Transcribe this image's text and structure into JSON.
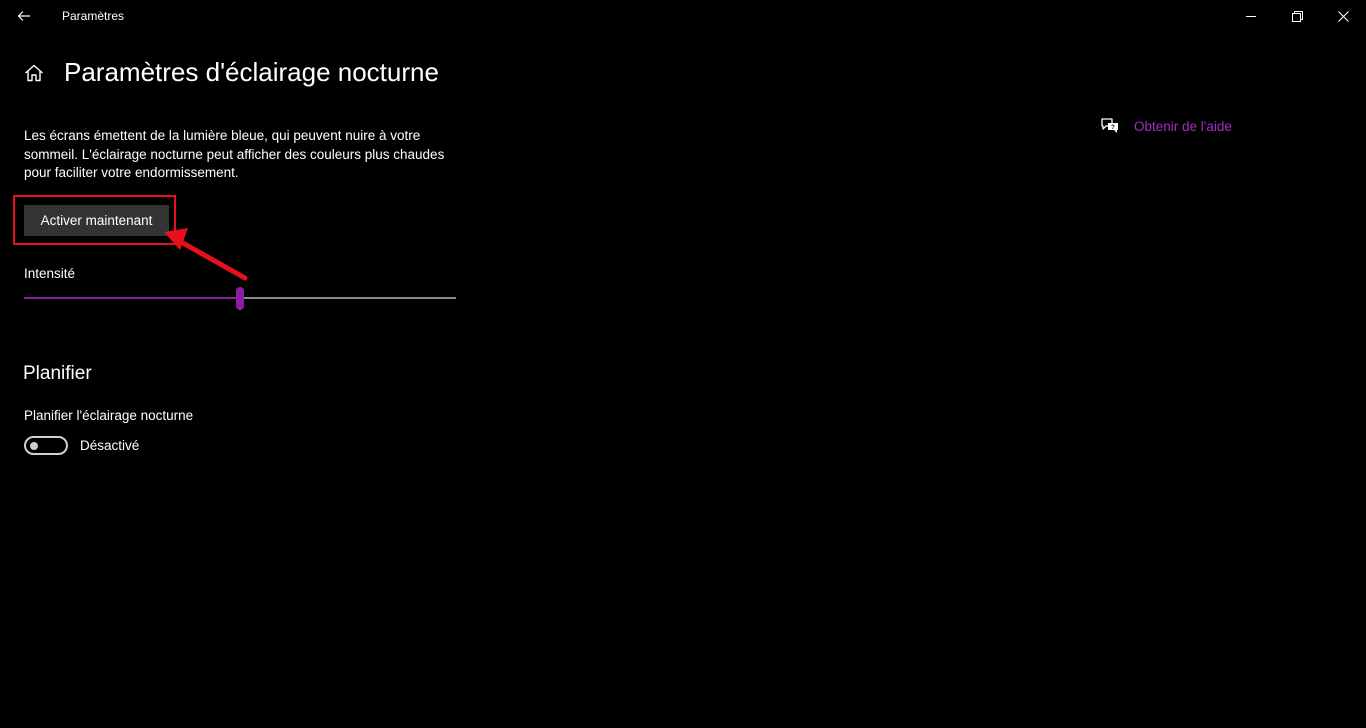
{
  "window": {
    "app_title": "Paramètres",
    "back_icon": "back-arrow-icon",
    "minimize_icon": "minimize-icon",
    "maximize_icon": "restore-icon",
    "close_icon": "close-icon"
  },
  "page": {
    "home_icon": "home-icon",
    "title": "Paramètres d'éclairage nocturne",
    "description": "Les écrans émettent de la lumière bleue, qui peuvent nuire à votre sommeil. L'éclairage nocturne peut afficher des couleurs plus chaudes pour faciliter votre endormissement.",
    "activate_button": "Activer maintenant",
    "intensity_label": "Intensité",
    "intensity_percent": 50
  },
  "schedule": {
    "section_title": "Planifier",
    "label": "Planifier l'éclairage nocturne",
    "toggle_state": "Désactivé",
    "toggle_on": false
  },
  "help": {
    "icon": "chat-help-icon",
    "link": "Obtenir de l'aide"
  },
  "annotation": {
    "highlight_color": "#e8101a"
  },
  "colors": {
    "accent": "#8a1fa0",
    "link": "#a62ebf",
    "background": "#000000",
    "button": "#333333"
  }
}
